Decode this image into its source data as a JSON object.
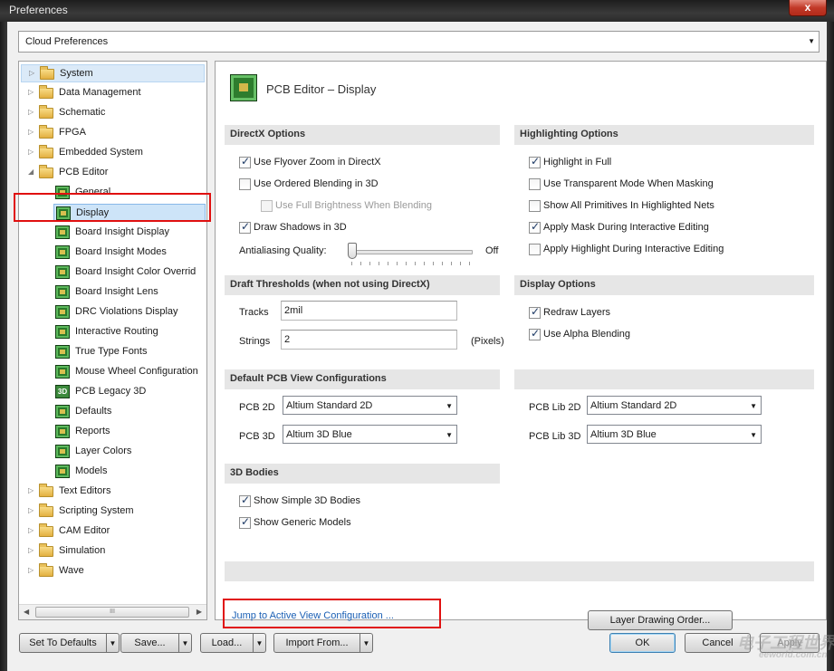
{
  "window": {
    "title": "Preferences",
    "close_label": "x"
  },
  "cloud_select": {
    "value": "Cloud Preferences"
  },
  "tree": {
    "items": [
      {
        "label": "System",
        "expander": "▷"
      },
      {
        "label": "Data Management",
        "expander": "▷"
      },
      {
        "label": "Schematic",
        "expander": "▷"
      },
      {
        "label": "FPGA",
        "expander": "▷"
      },
      {
        "label": "Embedded System",
        "expander": "▷"
      },
      {
        "label": "PCB Editor",
        "expander": "◢"
      },
      {
        "label": "General"
      },
      {
        "label": "Display"
      },
      {
        "label": "Board Insight Display"
      },
      {
        "label": "Board Insight Modes"
      },
      {
        "label": "Board Insight Color Overrid"
      },
      {
        "label": "Board Insight Lens"
      },
      {
        "label": "DRC Violations Display"
      },
      {
        "label": "Interactive Routing"
      },
      {
        "label": "True Type Fonts"
      },
      {
        "label": "Mouse Wheel Configuration"
      },
      {
        "label": "PCB Legacy 3D",
        "icon_text": "3D"
      },
      {
        "label": "Defaults"
      },
      {
        "label": "Reports"
      },
      {
        "label": "Layer Colors"
      },
      {
        "label": "Models"
      },
      {
        "label": "Text Editors",
        "expander": "▷"
      },
      {
        "label": "Scripting System",
        "expander": "▷"
      },
      {
        "label": "CAM Editor",
        "expander": "▷"
      },
      {
        "label": "Simulation",
        "expander": "▷"
      },
      {
        "label": "Wave",
        "expander": "▷"
      }
    ],
    "scroll_left": "◀",
    "scroll_right": "▶",
    "scroll_grip": "III"
  },
  "page": {
    "title": "PCB Editor – Display"
  },
  "directx": {
    "header": "DirectX Options",
    "flyover": {
      "label": "Use Flyover Zoom in DirectX",
      "checked": true
    },
    "ordered_blending": {
      "label": "Use Ordered Blending in 3D",
      "checked": false
    },
    "full_brightness": {
      "label": "Use Full Brightness When Blending",
      "checked": false,
      "disabled": true
    },
    "draw_shadows": {
      "label": "Draw Shadows in 3D",
      "checked": true
    },
    "antialiasing_label": "Antialiasing Quality:",
    "antialiasing_value": "Off",
    "antialiasing_level": 0
  },
  "highlighting": {
    "header": "Highlighting Options",
    "items": [
      {
        "label": "Highlight in Full",
        "checked": true
      },
      {
        "label": "Use Transparent Mode When Masking",
        "checked": false
      },
      {
        "label": "Show All Primitives In Highlighted Nets",
        "checked": false
      },
      {
        "label": "Apply Mask During Interactive Editing",
        "checked": true
      },
      {
        "label": "Apply Highlight During Interactive Editing",
        "checked": false
      }
    ]
  },
  "draft": {
    "header": "Draft Thresholds (when not using DirectX)",
    "tracks_label": "Tracks",
    "tracks_value": "2mil",
    "strings_label": "Strings",
    "strings_value": "2",
    "strings_unit": "(Pixels)"
  },
  "display_options": {
    "header": "Display Options",
    "items": [
      {
        "label": "Redraw Layers",
        "checked": true
      },
      {
        "label": "Use Alpha Blending",
        "checked": true
      }
    ]
  },
  "view_config": {
    "header": "Default PCB View Configurations",
    "pcb2d_label": "PCB 2D",
    "pcb2d_value": "Altium Standard 2D",
    "pcb3d_label": "PCB 3D",
    "pcb3d_value": "Altium 3D Blue",
    "lib2d_label": "PCB Lib 2D",
    "lib2d_value": "Altium Standard 2D",
    "lib3d_label": "PCB Lib 3D",
    "lib3d_value": "Altium 3D Blue"
  },
  "bodies": {
    "header": "3D Bodies",
    "items": [
      {
        "label": "Show Simple 3D Bodies",
        "checked": true
      },
      {
        "label": "Show Generic Models",
        "checked": true
      }
    ]
  },
  "links": {
    "jump": "Jump to Active View Configuration ..."
  },
  "buttons": {
    "layer_order": "Layer Drawing Order...",
    "set_defaults": "Set To Defaults",
    "save": "Save...",
    "load": "Load...",
    "import_from": "Import From...",
    "ok": "OK",
    "cancel": "Cancel",
    "apply": "Apply",
    "dropdown_arrow": "▼"
  },
  "watermark": {
    "text": "电子工程世界",
    "sub": "eeworld.com.cn"
  }
}
